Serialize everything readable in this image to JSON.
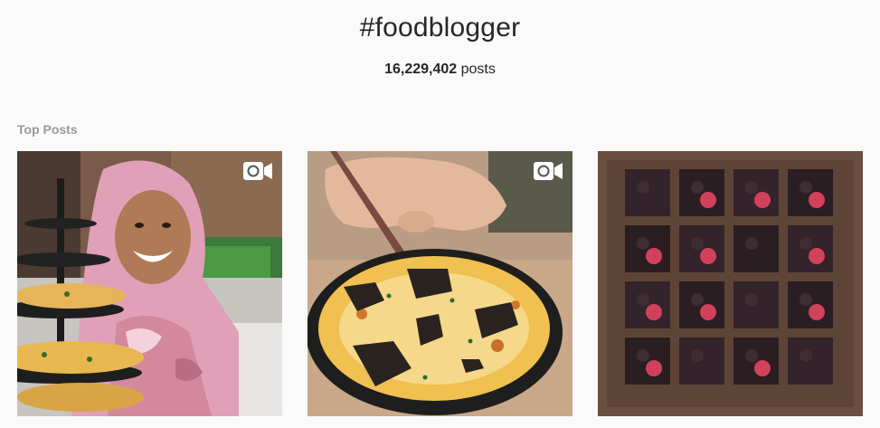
{
  "header": {
    "hashtag": "#foodblogger",
    "post_count": "16,229,402",
    "post_count_suffix": " posts"
  },
  "top_posts": {
    "label": "Top Posts",
    "items": [
      {
        "subject": "woman in pink patterned hijab with tiered pasta stand",
        "is_video": true
      },
      {
        "subject": "cast iron skillet of cheesy baked dish with crispy topping and fork",
        "is_video": true
      },
      {
        "subject": "chocolate brownie squares with raspberries",
        "is_video": false
      }
    ]
  },
  "icons": {
    "video": "video-camera-icon"
  }
}
